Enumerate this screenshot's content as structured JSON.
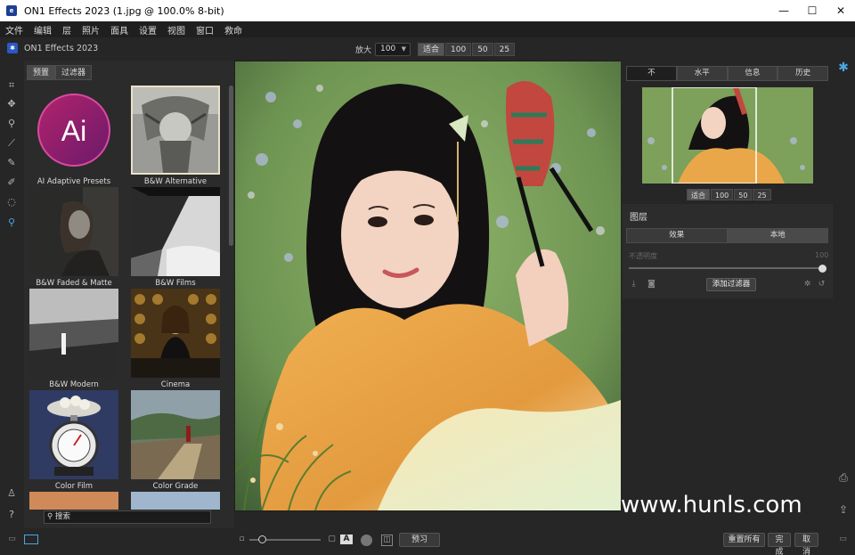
{
  "window": {
    "title": "ON1 Effects 2023 (1.jpg @ 100.0% 8-bit)",
    "app_icon_text": "e",
    "minimize": "—",
    "maximize": "☐",
    "close": "✕"
  },
  "menu": [
    "文件",
    "编辑",
    "层",
    "照片",
    "面具",
    "设置",
    "视图",
    "窗口",
    "救命"
  ],
  "toolbar": {
    "app_name": "ON1 Effects 2023",
    "zoom_label": "放大",
    "zoom_value": "100",
    "zoom_buttons": [
      "适合",
      "100",
      "50",
      "25"
    ]
  },
  "browser": {
    "tabs": [
      "预置",
      "过滤器"
    ],
    "presets": [
      {
        "label": "AI Adaptive Presets"
      },
      {
        "label": "B&W Alternative"
      },
      {
        "label": "B&W Faded & Matte"
      },
      {
        "label": "B&W Films"
      },
      {
        "label": "B&W Modern"
      },
      {
        "label": "Cinema"
      },
      {
        "label": "Color Film"
      },
      {
        "label": "Color Grade"
      }
    ],
    "ai_badge": "Ai",
    "search_placeholder": "搜索"
  },
  "navigator": {
    "tabs": [
      "不",
      "水平",
      "信息",
      "历史"
    ],
    "zoom_buttons": [
      "适合",
      "100",
      "50",
      "25"
    ]
  },
  "layers": {
    "title": "图层",
    "tabs": [
      "效果",
      "本地"
    ],
    "opacity_label": "不透明度",
    "opacity_value": "100",
    "add_filter": "添加过滤器"
  },
  "bottom": {
    "preview_button": "预习",
    "reset_button": "重置所有",
    "done_button": "完成",
    "cancel_button": "取消"
  },
  "watermark": "www.hunls.com",
  "colors": {
    "accent": "#4aa6e6",
    "panel": "#262626"
  }
}
